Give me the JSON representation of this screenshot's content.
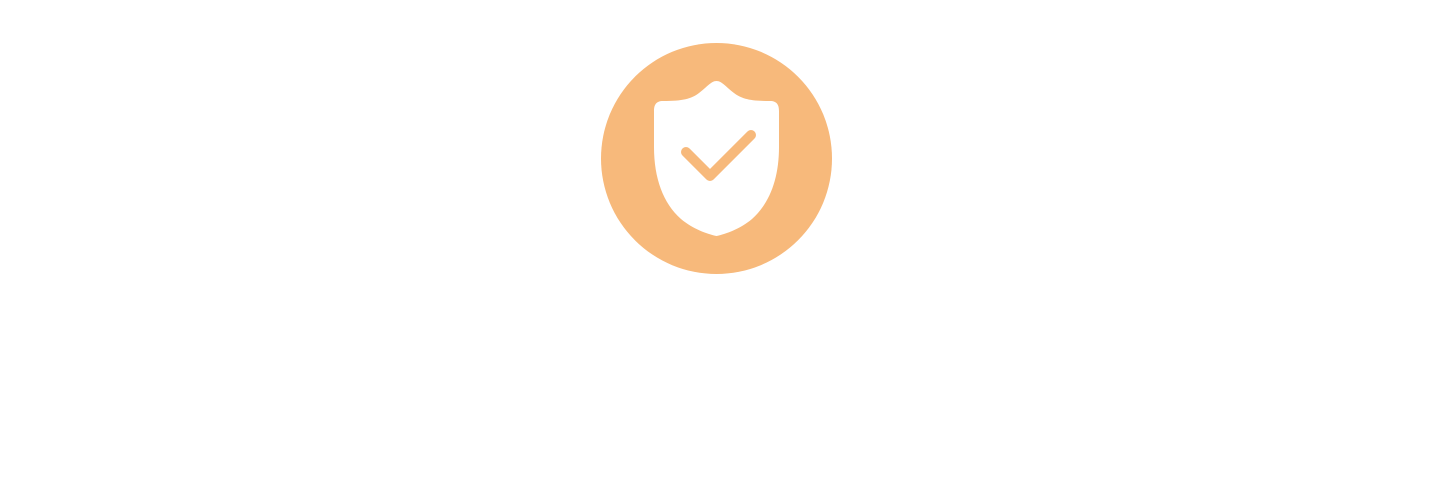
{
  "colors": {
    "page_background": "#FFFFFF",
    "accent_circle": "#F7B97B",
    "icon_fill": "#FFFFFF"
  },
  "icons": {
    "main": "shield-check-icon"
  }
}
